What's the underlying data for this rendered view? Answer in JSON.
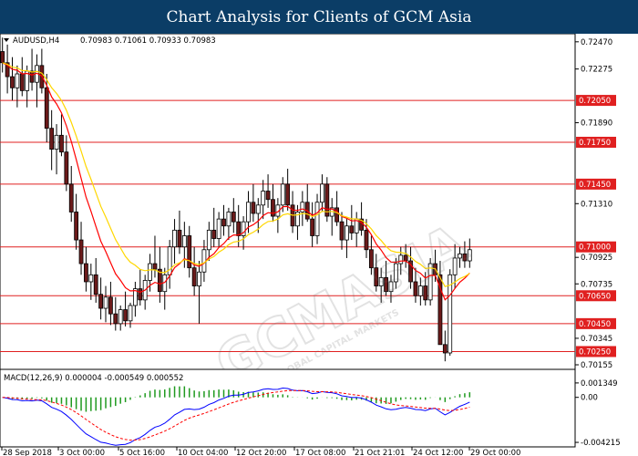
{
  "banner": {
    "title": "Chart Analysis for Clients of GCM Asia"
  },
  "chart_data": [
    {
      "type": "candlestick",
      "symbol": "AUDUSD,H4",
      "header": "0.70983 0.71061 0.70933 0.70983",
      "ylim": [
        0.70155,
        0.72495
      ],
      "y_ticks": [
        "0.72470",
        "0.72275",
        "0.72050",
        "0.71890",
        "0.71750",
        "0.71450",
        "0.71310",
        "0.71000",
        "0.70925",
        "0.70735",
        "0.70650",
        "0.70450",
        "0.70345",
        "0.70250",
        "0.70155"
      ],
      "x_ticks": [
        "28 Sep 2018",
        "3 Oct 00:00",
        "5 Oct 16:00",
        "10 Oct 04:00",
        "12 Oct 20:00",
        "17 Oct 08:00",
        "21 Oct 21:01",
        "24 Oct 12:00",
        "29 Oct 00:00"
      ],
      "levels": [
        "0.72050",
        "0.71750",
        "0.71450",
        "0.71000",
        "0.70650",
        "0.70450",
        "0.70250"
      ],
      "ma_colors": [
        "#ff0000",
        "#ffd700"
      ],
      "candles": [
        [
          0.724,
          0.725,
          0.7225,
          0.7232
        ],
        [
          0.7232,
          0.7245,
          0.721,
          0.7222
        ],
        [
          0.7222,
          0.7236,
          0.7205,
          0.7214
        ],
        [
          0.7214,
          0.723,
          0.72,
          0.7224
        ],
        [
          0.7224,
          0.7236,
          0.7208,
          0.7212
        ],
        [
          0.7212,
          0.723,
          0.72,
          0.7226
        ],
        [
          0.7226,
          0.7242,
          0.7212,
          0.7218
        ],
        [
          0.7218,
          0.7238,
          0.72,
          0.723
        ],
        [
          0.723,
          0.7242,
          0.721,
          0.7214
        ],
        [
          0.7214,
          0.7224,
          0.7175,
          0.7185
        ],
        [
          0.7185,
          0.7198,
          0.7155,
          0.717
        ],
        [
          0.717,
          0.7188,
          0.7152,
          0.718
        ],
        [
          0.718,
          0.7195,
          0.7165,
          0.7168
        ],
        [
          0.7168,
          0.718,
          0.714,
          0.7145
        ],
        [
          0.7145,
          0.7158,
          0.7118,
          0.7125
        ],
        [
          0.7125,
          0.7138,
          0.7098,
          0.7105
        ],
        [
          0.7105,
          0.7118,
          0.708,
          0.7088
        ],
        [
          0.7088,
          0.71,
          0.7068,
          0.7075
        ],
        [
          0.7075,
          0.7088,
          0.7062,
          0.708
        ],
        [
          0.708,
          0.7092,
          0.706,
          0.7066
        ],
        [
          0.7066,
          0.7078,
          0.7048,
          0.7056
        ],
        [
          0.7056,
          0.7072,
          0.7046,
          0.7064
        ],
        [
          0.7064,
          0.7075,
          0.7044,
          0.7052
        ],
        [
          0.7052,
          0.7064,
          0.704,
          0.7045
        ],
        [
          0.7045,
          0.7058,
          0.704,
          0.7055
        ],
        [
          0.7055,
          0.7068,
          0.7043,
          0.7047
        ],
        [
          0.7047,
          0.706,
          0.7042,
          0.7058
        ],
        [
          0.7058,
          0.7075,
          0.705,
          0.707
        ],
        [
          0.707,
          0.7084,
          0.7058,
          0.7062
        ],
        [
          0.7062,
          0.708,
          0.7055,
          0.7076
        ],
        [
          0.7076,
          0.7095,
          0.7068,
          0.7088
        ],
        [
          0.7088,
          0.7108,
          0.7078,
          0.7084
        ],
        [
          0.7084,
          0.71,
          0.706,
          0.7068
        ],
        [
          0.7068,
          0.7085,
          0.7055,
          0.708
        ],
        [
          0.708,
          0.7105,
          0.707,
          0.71
        ],
        [
          0.71,
          0.712,
          0.7088,
          0.7112
        ],
        [
          0.7112,
          0.7126,
          0.7095,
          0.71
        ],
        [
          0.71,
          0.7118,
          0.7085,
          0.7108
        ],
        [
          0.7108,
          0.7115,
          0.7078,
          0.7085
        ],
        [
          0.7085,
          0.71,
          0.7065,
          0.7072
        ],
        [
          0.7072,
          0.709,
          0.7045,
          0.7082
        ],
        [
          0.7082,
          0.7105,
          0.7075,
          0.7098
        ],
        [
          0.7098,
          0.7118,
          0.709,
          0.7112
        ],
        [
          0.7112,
          0.7128,
          0.71,
          0.7106
        ],
        [
          0.7106,
          0.7125,
          0.71,
          0.712
        ],
        [
          0.712,
          0.713,
          0.7108,
          0.7115
        ],
        [
          0.7115,
          0.7128,
          0.7105,
          0.7125
        ],
        [
          0.7125,
          0.7135,
          0.711,
          0.7118
        ],
        [
          0.7118,
          0.713,
          0.71,
          0.7108
        ],
        [
          0.7108,
          0.7122,
          0.7098,
          0.7118
        ],
        [
          0.7118,
          0.714,
          0.711,
          0.7132
        ],
        [
          0.7132,
          0.7145,
          0.7118,
          0.7124
        ],
        [
          0.7124,
          0.7135,
          0.711,
          0.713
        ],
        [
          0.713,
          0.7148,
          0.712,
          0.714
        ],
        [
          0.714,
          0.7152,
          0.7128,
          0.7134
        ],
        [
          0.7134,
          0.7145,
          0.7118,
          0.7122
        ],
        [
          0.7122,
          0.7135,
          0.711,
          0.713
        ],
        [
          0.713,
          0.715,
          0.7125,
          0.7145
        ],
        [
          0.7145,
          0.7156,
          0.7126,
          0.713
        ],
        [
          0.713,
          0.714,
          0.711,
          0.7115
        ],
        [
          0.7115,
          0.713,
          0.7105,
          0.7125
        ],
        [
          0.7125,
          0.714,
          0.7115,
          0.7132
        ],
        [
          0.7132,
          0.7145,
          0.7118,
          0.712
        ],
        [
          0.712,
          0.7132,
          0.71,
          0.7108
        ],
        [
          0.7108,
          0.7138,
          0.7102,
          0.7132
        ],
        [
          0.7132,
          0.7152,
          0.7125,
          0.7145
        ],
        [
          0.7145,
          0.715,
          0.7118,
          0.7122
        ],
        [
          0.7122,
          0.7135,
          0.7108,
          0.7128
        ],
        [
          0.7128,
          0.714,
          0.7115,
          0.7118
        ],
        [
          0.7118,
          0.7125,
          0.7098,
          0.7105
        ],
        [
          0.7105,
          0.712,
          0.7092,
          0.7115
        ],
        [
          0.7115,
          0.713,
          0.7105,
          0.711
        ],
        [
          0.711,
          0.7125,
          0.71,
          0.712
        ],
        [
          0.712,
          0.7132,
          0.7108,
          0.7112
        ],
        [
          0.7112,
          0.712,
          0.7092,
          0.7098
        ],
        [
          0.7098,
          0.7108,
          0.708,
          0.7085
        ],
        [
          0.7085,
          0.7095,
          0.7068,
          0.7072
        ],
        [
          0.7072,
          0.7085,
          0.706,
          0.7078
        ],
        [
          0.7078,
          0.709,
          0.7065,
          0.7068
        ],
        [
          0.7068,
          0.708,
          0.706,
          0.7075
        ],
        [
          0.7075,
          0.7092,
          0.707,
          0.7088
        ],
        [
          0.7088,
          0.71,
          0.708,
          0.7094
        ],
        [
          0.7094,
          0.7102,
          0.7085,
          0.709
        ],
        [
          0.709,
          0.71,
          0.707,
          0.7075
        ],
        [
          0.7075,
          0.7085,
          0.706,
          0.7065
        ],
        [
          0.7065,
          0.7078,
          0.7058,
          0.7072
        ],
        [
          0.7072,
          0.7082,
          0.7058,
          0.7062
        ],
        [
          0.7062,
          0.7092,
          0.7058,
          0.7088
        ],
        [
          0.7088,
          0.7098,
          0.7075,
          0.708
        ],
        [
          0.708,
          0.709,
          0.704,
          0.703
        ],
        [
          0.703,
          0.704,
          0.7018,
          0.7024
        ],
        [
          0.7024,
          0.7084,
          0.7022,
          0.708
        ],
        [
          0.708,
          0.7102,
          0.707,
          0.7092
        ],
        [
          0.7092,
          0.71,
          0.7085,
          0.7095
        ],
        [
          0.7095,
          0.7104,
          0.7085,
          0.709
        ],
        [
          0.709,
          0.7106,
          0.7085,
          0.7098
        ]
      ]
    },
    {
      "type": "macd",
      "label": "MACD(12,26,9) 0.000004 -0.000549 0.000552",
      "ylim": [
        -0.00421,
        0.00134
      ],
      "y_ticks": [
        "0.001349",
        "0.00",
        "-0.004215"
      ],
      "line_colors": {
        "histogram": "#1f9a1f",
        "macd": "#0000ff",
        "signal": "#ff0000"
      }
    }
  ],
  "watermark": {
    "text": "GCMASIA",
    "subtext": "GLOBAL CAPITAL MARKETS"
  }
}
